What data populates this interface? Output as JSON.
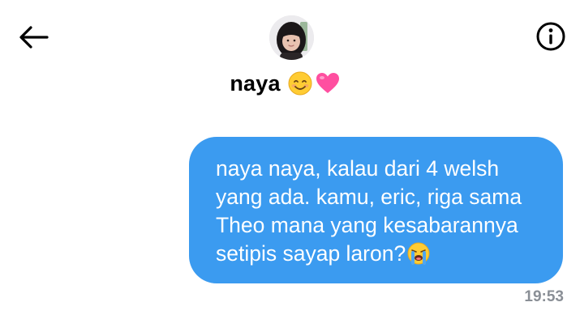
{
  "header": {
    "back_icon": "arrow-left-icon",
    "info_icon": "info-circle-icon",
    "contact": {
      "name": "naya",
      "emojis": [
        "smiling-face-emoji",
        "pink-heart-emoji"
      ]
    }
  },
  "message": {
    "lines": [
      "naya naya, kalau dari 4 welsh",
      "yang ada. kamu, eric, riga sama",
      "Theo mana yang kesabarannya",
      "setipis sayap laron?"
    ],
    "trailing_emoji": "loudly-crying-face-emoji",
    "timestamp": "19:53"
  },
  "colors": {
    "bubble": "#3b9bf0",
    "bubble_text": "#ffffff",
    "timestamp": "#8a8f96",
    "heart": "#ff4fa0",
    "emoji_face": "#ffcc33"
  }
}
